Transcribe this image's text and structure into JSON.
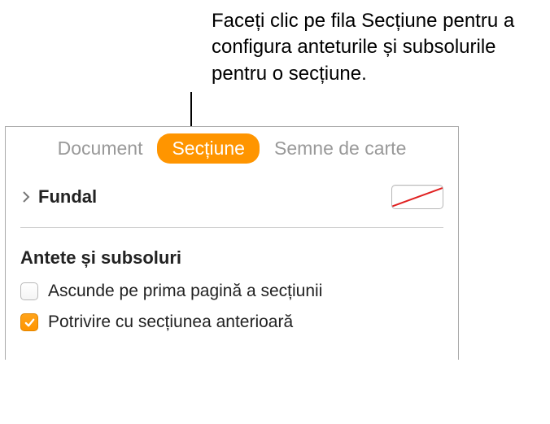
{
  "callout": {
    "text": "Faceți clic pe fila Secțiune pentru a configura anteturile și subsolurile pentru o secțiune."
  },
  "tabs": {
    "document": "Document",
    "section": "Secțiune",
    "bookmarks": "Semne de carte"
  },
  "fundal": {
    "label": "Fundal"
  },
  "headers_footers": {
    "heading": "Antete și subsoluri",
    "hide_first_label": "Ascunde pe prima pagină a secțiunii",
    "hide_first_checked": false,
    "match_prev_label": "Potrivire cu secțiunea anterioară",
    "match_prev_checked": true
  }
}
